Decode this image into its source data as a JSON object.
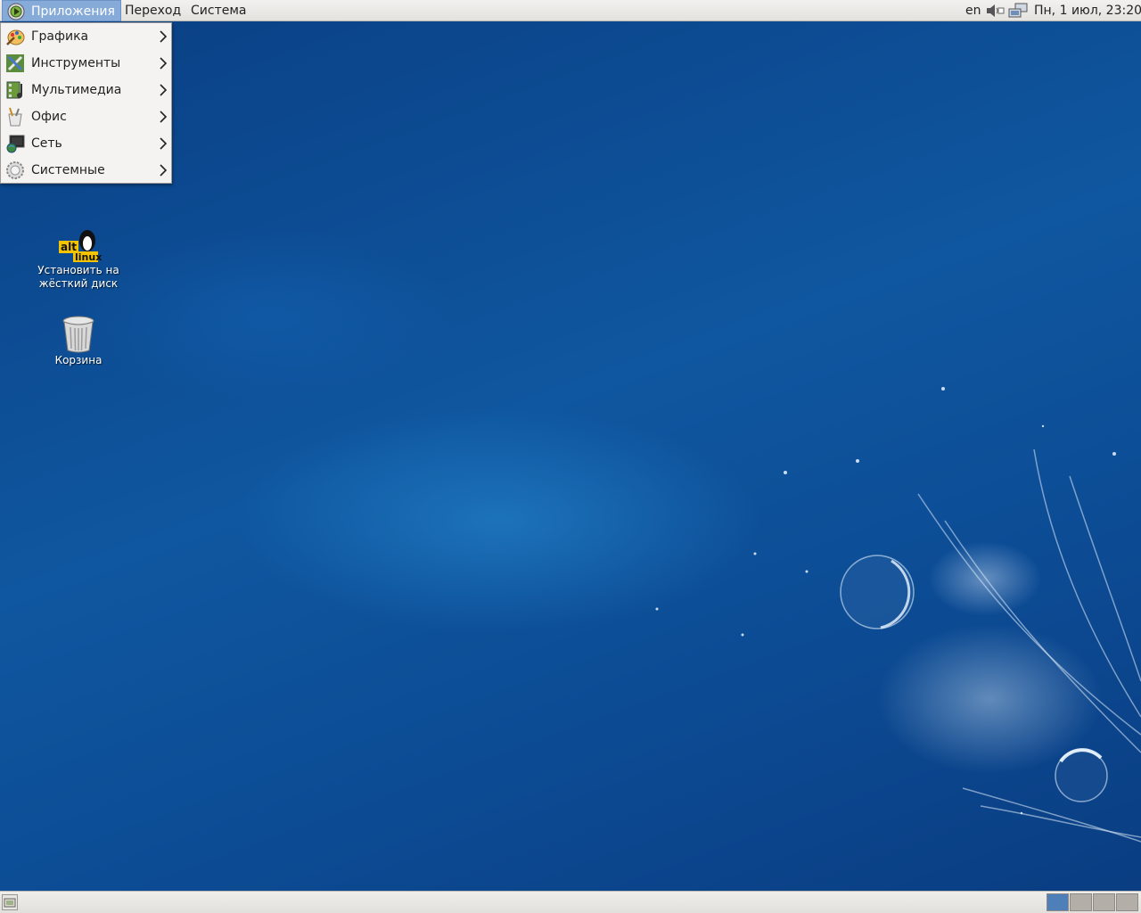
{
  "top_panel": {
    "menus": {
      "applications": "Приложения",
      "go": "Переход",
      "system": "Система"
    },
    "tray": {
      "keyboard_layout": "en",
      "clock": "Пн,  1 июл, 23:20"
    }
  },
  "applications_menu": {
    "items": [
      {
        "label": "Графика",
        "icon": "graphics-icon"
      },
      {
        "label": "Инструменты",
        "icon": "tools-icon"
      },
      {
        "label": "Мультимедиа",
        "icon": "multimedia-icon"
      },
      {
        "label": "Офис",
        "icon": "office-icon"
      },
      {
        "label": "Сеть",
        "icon": "network-icon"
      },
      {
        "label": "Системные",
        "icon": "system-icon"
      }
    ]
  },
  "desktop_icons": [
    {
      "label_line1": "Установить на",
      "label_line2": "жёсткий диск",
      "icon": "alt-linux-installer-icon",
      "logo_text_1": "alt",
      "logo_text_2": "linux"
    },
    {
      "label_line1": "Корзина",
      "icon": "trash-icon"
    }
  ],
  "bottom_panel": {
    "workspaces": 4,
    "active_workspace": 1
  },
  "colors": {
    "accent": "#86abd9",
    "desktop": "#0d4a8e",
    "panel": "#e9e7e4"
  }
}
